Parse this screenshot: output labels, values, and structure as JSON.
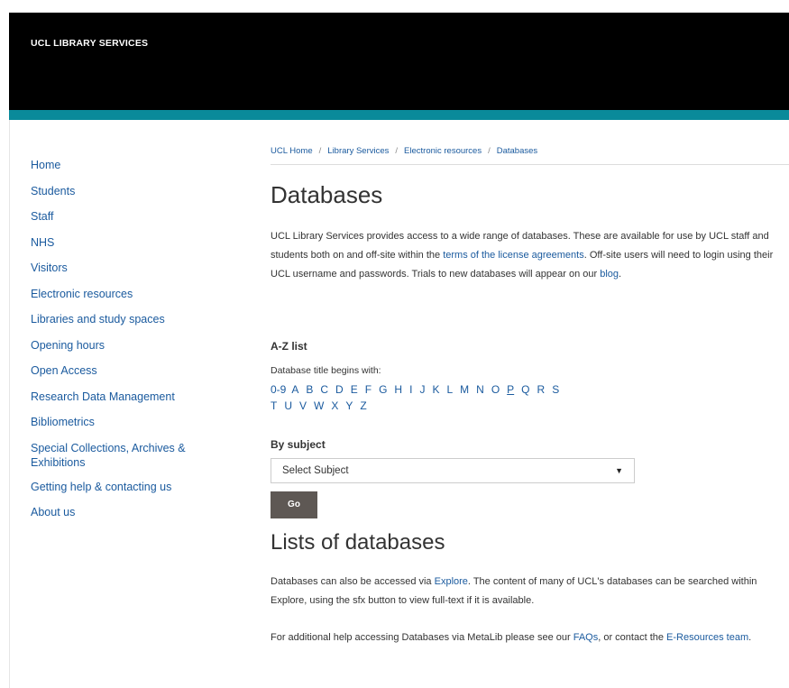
{
  "header": {
    "brand": "UCL LIBRARY SERVICES"
  },
  "sidebar": {
    "items": [
      {
        "label": "Home"
      },
      {
        "label": "Students"
      },
      {
        "label": "Staff"
      },
      {
        "label": "NHS"
      },
      {
        "label": "Visitors"
      },
      {
        "label": "Electronic resources"
      },
      {
        "label": "Libraries and study spaces"
      },
      {
        "label": "Opening hours"
      },
      {
        "label": "Open Access"
      },
      {
        "label": "Research Data Management"
      },
      {
        "label": "Bibliometrics"
      },
      {
        "label": "Special Collections, Archives & Exhibitions"
      },
      {
        "label": "Getting help & contacting us"
      },
      {
        "label": "About us"
      }
    ]
  },
  "breadcrumb": {
    "items": [
      "UCL Home",
      "Library Services",
      "Electronic resources",
      "Databases"
    ],
    "separator": "/"
  },
  "main": {
    "title": "Databases",
    "intro": {
      "text1": "UCL Library Services provides access to a wide range of databases. These are available for use by UCL staff and students both on and off-site within the ",
      "link1": "terms of the license agreements",
      "text2": ". Off-site users will need to login using their UCL username and passwords. Trials to new databases will appear on our ",
      "link2": "blog",
      "text3": "."
    },
    "az": {
      "heading": "A-Z list",
      "caption": "Database title begins with:",
      "row1": [
        "0-9",
        "A",
        "B",
        "C",
        "D",
        "E",
        "F",
        "G",
        "H",
        "I",
        "J",
        "K",
        "L",
        "M",
        "N",
        "O",
        "P",
        "Q",
        "R",
        "S"
      ],
      "row2": [
        "T",
        "U",
        "V",
        "W",
        "X",
        "Y",
        "Z"
      ],
      "active": "P"
    },
    "subject": {
      "heading": "By subject",
      "selected": "Select Subject",
      "arrow": "▼",
      "go": "Go"
    },
    "lists": {
      "title": "Lists of databases",
      "p1_text1": "Databases can also be accessed via ",
      "p1_link": "Explore",
      "p1_text2": ". The content of many of UCL's databases can be searched within Explore, using the sfx button to view full-text if it is available.",
      "p2_text1": "For additional help accessing Databases via MetaLib please see our ",
      "p2_link1": "FAQs",
      "p2_text2": ", or contact the ",
      "p2_link2": "E-Resources team",
      "p2_text3": "."
    }
  },
  "colors": {
    "header_bg": "#000000",
    "accent": "#0a8a9a",
    "link": "#1a5a9e",
    "button_bg": "#5e5854"
  }
}
